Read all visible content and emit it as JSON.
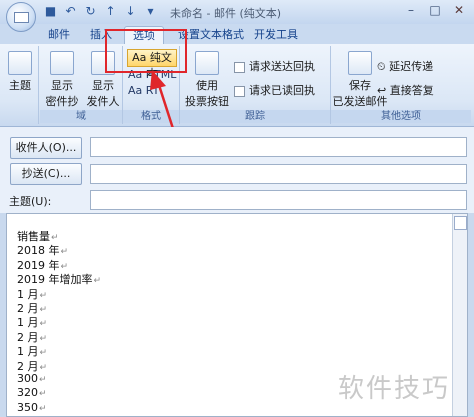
{
  "window": {
    "title": "未命名 - 邮件 (纯文本)"
  },
  "tabs": [
    "邮件",
    "插入",
    "选项",
    "设置文本格式",
    "开发工具"
  ],
  "ribbon": {
    "theme_label": "主题",
    "show_bcc_line1": "显示",
    "show_bcc_line2": "密件抄送",
    "show_from_line1": "显示",
    "show_from_line2": "发件人",
    "group_fields": "域",
    "plain_text": "Aa 纯文本",
    "html": "Aa HTML",
    "rich_text": "Aa RT",
    "group_format": "格式",
    "voting_line1": "使用",
    "voting_line2": "投票按钮",
    "request_delivery": "请求送达回执",
    "request_read": "请求已读回执",
    "group_tracking": "跟踪",
    "save_sent_line1": "保存",
    "save_sent_line2": "已发送邮件",
    "delay_delivery": "延迟传递",
    "direct_reply": "直接答复",
    "group_more": "其他选项"
  },
  "form": {
    "to_label": "收件人(O)...",
    "cc_label": "抄送(C)...",
    "subject_label": "主题(U):"
  },
  "body_lines": [
    "销售量",
    "2018 年",
    "2019 年",
    "2019 年增加率",
    "1 月",
    "2 月",
    "1 月",
    "2 月",
    "1 月",
    "2 月",
    "300",
    "320",
    "350"
  ],
  "watermark": "软件技巧",
  "colors": {
    "highlight": "#e0262b"
  }
}
